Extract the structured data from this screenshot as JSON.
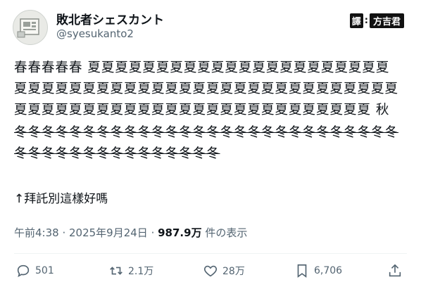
{
  "author": {
    "display_name": "敗北者シェスカント",
    "handle": "@syesukanto2"
  },
  "credit": {
    "tag": "譯",
    "separator": ":",
    "by": "方吉君"
  },
  "tweet": {
    "line1": "春春春春春 夏夏夏夏夏夏夏夏夏夏夏夏夏夏夏夏夏夏夏夏夏夏",
    "line2": "夏夏夏夏夏夏夏夏夏夏夏夏夏夏夏夏夏夏夏夏夏夏夏夏夏夏夏夏",
    "line3": "夏夏夏夏夏夏夏夏夏夏夏夏夏夏夏夏夏夏夏夏夏夏夏夏夏夏 秋",
    "line4": "冬冬冬冬冬冬冬冬冬冬冬冬冬冬冬冬冬冬冬冬冬冬冬冬冬冬冬冬",
    "line5": "冬冬冬冬冬冬冬冬冬冬冬冬冬冬冬",
    "plea": "↑拜託別這樣好嗎"
  },
  "meta": {
    "time": "午前4:38",
    "dot1": " · ",
    "date": "2025年9月24日",
    "dot2": " · ",
    "views": "987.9万",
    "views_suffix": " 件の表示"
  },
  "actions": {
    "reply_count": "501",
    "retweet_count": "2.1万",
    "like_count": "28万",
    "bookmark_count": "6,706"
  },
  "icons": {
    "reply": "reply-icon",
    "retweet": "retweet-icon",
    "like": "heart-icon",
    "bookmark": "bookmark-icon",
    "share": "share-icon"
  }
}
